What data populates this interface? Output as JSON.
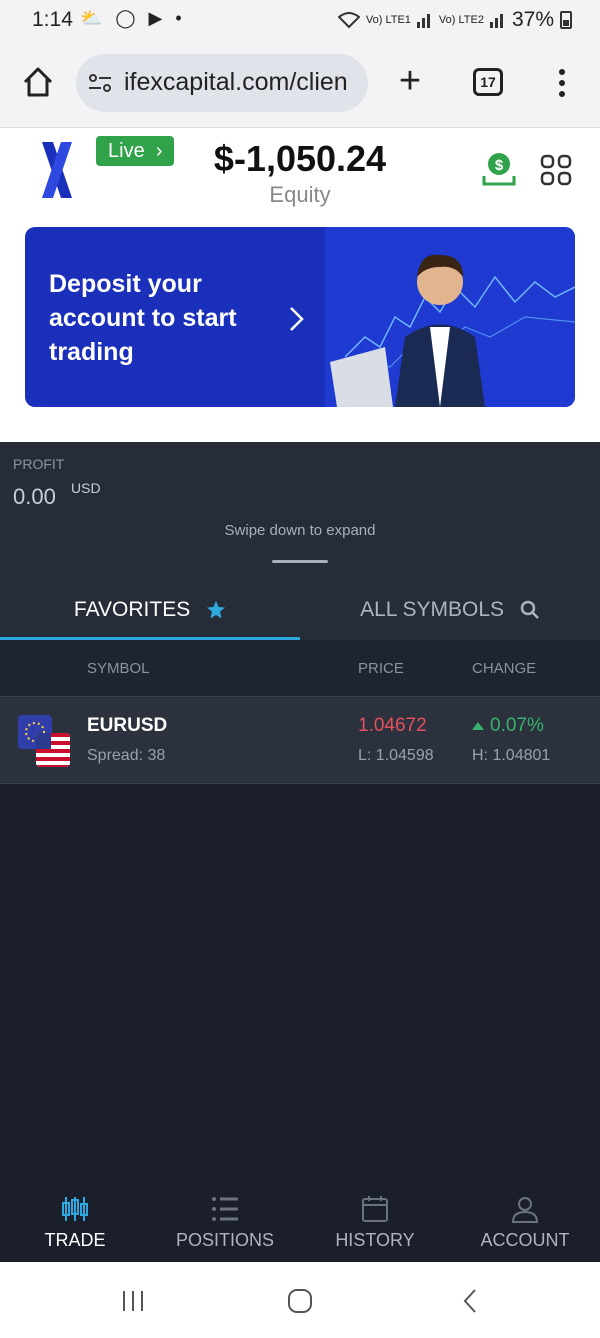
{
  "status_bar": {
    "time": "1:14",
    "notif_icons": "⛅ ◯ ▶ •",
    "signal1": "Vo) LTE1",
    "signal2": "Vo) LTE2",
    "battery": "37%"
  },
  "browser": {
    "url": "ifexcapital.com/clien",
    "tab_count": "17"
  },
  "header": {
    "live_label": "Live",
    "equity_value": "$-1,050.24",
    "equity_label": "Equity"
  },
  "banner": {
    "text": "Deposit your account to start trading"
  },
  "profit": {
    "label": "PROFIT",
    "value": "0.00",
    "unit": "USD",
    "swipe_hint": "Swipe down to expand"
  },
  "tabs": {
    "favorites": "FAVORITES",
    "all_symbols": "ALL SYMBOLS"
  },
  "table": {
    "headers": {
      "symbol": "SYMBOL",
      "price": "PRICE",
      "change": "CHANGE"
    },
    "rows": [
      {
        "symbol": "EURUSD",
        "spread": "Spread: 38",
        "price": "1.04672",
        "low": "L: 1.04598",
        "change": "0.07%",
        "high": "H: 1.04801"
      }
    ]
  },
  "bottom_nav": {
    "trade": "TRADE",
    "positions": "POSITIONS",
    "history": "HISTORY",
    "account": "ACCOUNT"
  },
  "colors": {
    "accent": "#2ea8e0",
    "live": "#2fa24a",
    "price_down": "#e5525d",
    "change_up": "#37b26c",
    "banner": "#1a2fba"
  }
}
